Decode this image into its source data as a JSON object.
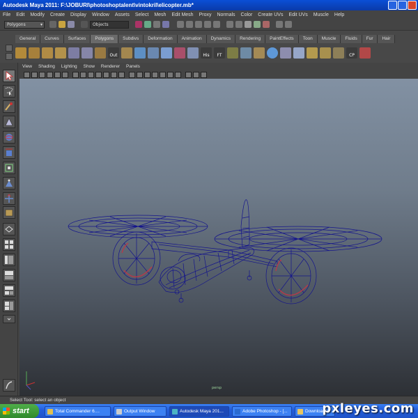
{
  "window": {
    "title": "Autodesk Maya 2011: F:\\JOBURI\\photoshoptalent\\vintokril\\elicopter.mb*"
  },
  "menubar": {
    "items": [
      "File",
      "Edit",
      "Modify",
      "Create",
      "Display",
      "Window",
      "Assets",
      "Select",
      "Mesh",
      "Edit Mesh",
      "Proxy",
      "Normals",
      "Color",
      "Create UVs",
      "Edit UVs",
      "Muscle",
      "Help"
    ]
  },
  "statusline": {
    "mode_dropdown": "Polygons",
    "selection_field": "Objects"
  },
  "shelf": {
    "tabs": [
      "General",
      "Curves",
      "Surfaces",
      "Polygons",
      "Subdivs",
      "Deformation",
      "Animation",
      "Dynamics",
      "Rendering",
      "PaintEffects",
      "Toon",
      "Muscle",
      "Fluids",
      "Fur",
      "Hair"
    ],
    "active_tab": "Polygons",
    "icon_labels": [
      "Out",
      "His",
      "FT",
      "CP"
    ]
  },
  "panel": {
    "menus": [
      "View",
      "Shading",
      "Lighting",
      "Show",
      "Renderer",
      "Panels"
    ]
  },
  "viewport": {
    "camera_label": "persp"
  },
  "helpline": {
    "text": "Select Tool: select an object"
  },
  "taskbar": {
    "start_label": "start",
    "tasks": [
      "Total Commander 6....",
      "Output Window",
      "Autodesk Maya 201...",
      "Adobe Photoshop - [...",
      "Downloads"
    ]
  },
  "watermark": {
    "text": "pxleyes.com"
  },
  "colors": {
    "wireframe": "#14148c",
    "highlight": "#b43a4a",
    "titlebar": "#0a4fd6",
    "taskbar": "#245edb",
    "start": "#3a9a35"
  }
}
